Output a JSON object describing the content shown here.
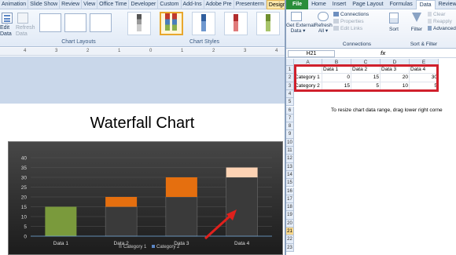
{
  "ppt": {
    "tabs": [
      "Animation",
      "Slide Show",
      "Review",
      "View",
      "Office Time",
      "Developer",
      "Custom",
      "Add-Ins",
      "Adobe Pre",
      "Presenterm",
      "Design",
      "Layo"
    ],
    "active_tab": "Design",
    "ribbon": {
      "edit_data_label": "Edit\nData",
      "refresh_data_label": "Refresh\nData",
      "chart_layouts_label": "Chart Layouts",
      "chart_styles_label": "Chart Styles"
    },
    "ruler_marks": [
      "4",
      "3",
      "2",
      "1",
      "0",
      "1",
      "2",
      "3",
      "4"
    ],
    "slide_title": "Waterfall Chart"
  },
  "excel": {
    "tabs": [
      "File",
      "Home",
      "Insert",
      "Page Layout",
      "Formulas",
      "Data",
      "Review"
    ],
    "active_tab": "Data",
    "ribbon": {
      "get_external": "Get External\nData ▾",
      "refresh_all": "Refresh\nAll ▾",
      "connections": "Connections",
      "properties": "Properties",
      "edit_links": "Edit Links",
      "group_connections": "Connections",
      "sort": "Sort",
      "filter": "Filter",
      "clear": "Clear",
      "reapply": "Reapply",
      "advanced": "Advanced",
      "group_sort_filter": "Sort & Filter"
    },
    "namebox": "H21",
    "fx_label": "fx",
    "columns": [
      "A",
      "B",
      "C",
      "D",
      "E"
    ],
    "rows": [
      "1",
      "2",
      "3",
      "4",
      "5",
      "6",
      "7",
      "8",
      "9",
      "10",
      "11",
      "12",
      "13",
      "14",
      "15",
      "16",
      "17",
      "18",
      "19",
      "20",
      "21",
      "22",
      "23"
    ],
    "selected_row": "21",
    "header_row": [
      "",
      "Data 1",
      "Data 2",
      "Data 3",
      "Data 4"
    ],
    "row2": [
      "Category 1",
      "0",
      "15",
      "20",
      "30"
    ],
    "row3": [
      "Category 2",
      "15",
      "5",
      "10",
      "5"
    ],
    "note": "To resize chart data range, drag lower right corne"
  },
  "chart_data": {
    "type": "bar",
    "stacked": true,
    "categories": [
      "Data 1",
      "Data 2",
      "Data 3",
      "Data 4"
    ],
    "series": [
      {
        "name": "Category 1",
        "values": [
          0,
          15,
          20,
          30
        ],
        "color": "#3a3a3a"
      },
      {
        "name": "Category 2",
        "values": [
          15,
          5,
          10,
          5
        ],
        "colors": [
          "#7a9a3c",
          "#e56f0f",
          "#e56f0f",
          "#fdd3b4"
        ]
      }
    ],
    "ylim": [
      0,
      40
    ],
    "yticks": [
      "0",
      "5",
      "10",
      "15",
      "20",
      "25",
      "30",
      "35",
      "40"
    ],
    "legend": "bottom",
    "grid": true
  },
  "colors": {
    "accent_red": "#d0202c",
    "excel_green": "#2a8d3a",
    "chart_bg": "#2b2b2b"
  }
}
